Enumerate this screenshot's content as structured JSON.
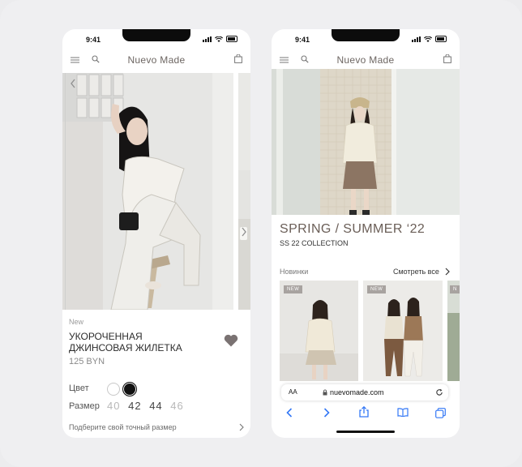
{
  "left_phone": {
    "status_time": "9:41",
    "brand": "Nuevo Made",
    "product": {
      "tag": "New",
      "name": "УКОРОЧЕННАЯ ДЖИНСОВАЯ ЖИЛЕТКА",
      "price": "125 BYN",
      "color_label": "Цвет",
      "colors": [
        "#ffffff",
        "#111111"
      ],
      "size_label": "Размер",
      "sizes": [
        "40",
        "42",
        "44",
        "46"
      ],
      "fit_link": "Подберите свой точный размер"
    }
  },
  "right_phone": {
    "status_time": "9:41",
    "brand": "Nuevo Made",
    "collection_title": "SPRING / SUMMER ‘22",
    "collection_subtitle": "SS 22 COLLECTION",
    "section_label": "Новинки",
    "see_all": "Смотреть все",
    "badges": [
      "NEW",
      "NEW",
      "N"
    ],
    "browser": {
      "aa_label": "AA",
      "url": "nuevomade.com"
    }
  }
}
